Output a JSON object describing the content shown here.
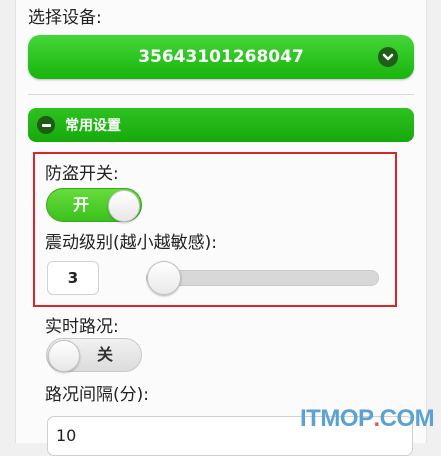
{
  "device": {
    "label": "选择设备:",
    "selected": "35643101268047",
    "dropdown_icon": "chevron-down-circle-icon"
  },
  "section": {
    "title": "常用设置",
    "collapse_icon": "minus-circle-icon"
  },
  "anti_theft": {
    "label": "防盗开关:",
    "state": "开",
    "on": true
  },
  "vibration": {
    "label": "震动级别(越小越敏感):",
    "value": "3"
  },
  "traffic": {
    "label": "实时路况:",
    "state": "关",
    "on": false
  },
  "interval": {
    "label": "路况间隔(分):",
    "value": "10"
  },
  "watermark": {
    "part1": "ITMOP",
    "part2": ".",
    "part3": "COM"
  },
  "colors": {
    "accent_green": "#19b40c",
    "highlight_red": "#d9262b"
  }
}
